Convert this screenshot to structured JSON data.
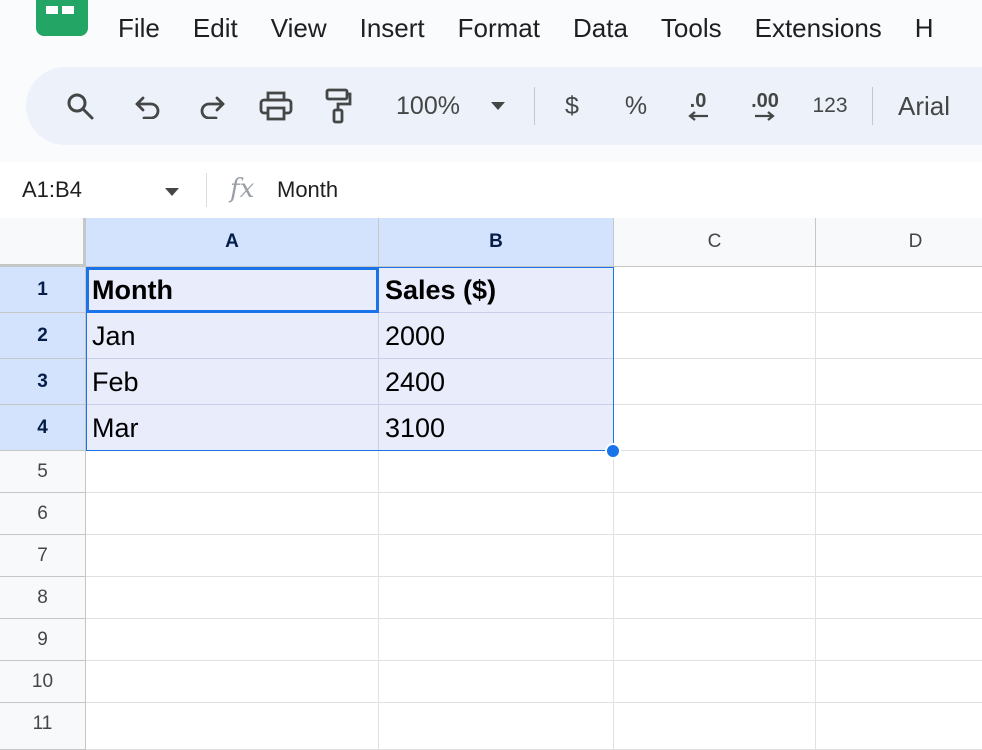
{
  "menu": [
    "File",
    "Edit",
    "View",
    "Insert",
    "Format",
    "Data",
    "Tools",
    "Extensions",
    "H"
  ],
  "toolbar": {
    "zoom": "100%",
    "currency": "$",
    "percent": "%",
    "decrease_decimals": ".0",
    "increase_decimals": ".00",
    "number_format": "123",
    "font": "Arial"
  },
  "formula_bar": {
    "name_box": "A1:B4",
    "fx": "fx",
    "value": "Month"
  },
  "columns": [
    "A",
    "B",
    "C",
    "D"
  ],
  "rows": [
    "1",
    "2",
    "3",
    "4",
    "5",
    "6",
    "7",
    "8",
    "9",
    "10",
    "11"
  ],
  "cells": [
    [
      "Month",
      "Sales ($)"
    ],
    [
      "Jan",
      "2000"
    ],
    [
      "Feb",
      "2400"
    ],
    [
      "Mar",
      "3100"
    ]
  ],
  "colors": {
    "selection": "#1a73e8",
    "selected_header": "#d3e3fd",
    "logo": "#23a566"
  }
}
